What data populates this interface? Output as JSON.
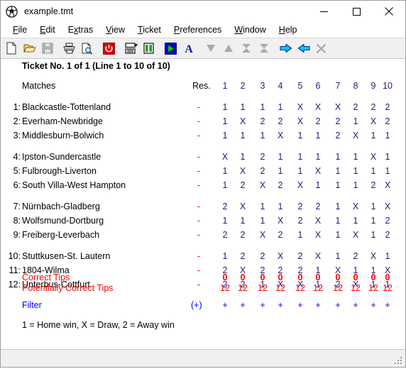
{
  "window": {
    "title": "example.tmt",
    "icon": "football-icon",
    "minimize_label": "─",
    "maximize_label": "□",
    "close_label": "✕"
  },
  "menu": [
    {
      "label": "File",
      "accel": "F"
    },
    {
      "label": "Edit",
      "accel": "E"
    },
    {
      "label": "Extras",
      "accel": "x"
    },
    {
      "label": "View",
      "accel": "V"
    },
    {
      "label": "Ticket",
      "accel": "T"
    },
    {
      "label": "Preferences",
      "accel": "P"
    },
    {
      "label": "Window",
      "accel": "W"
    },
    {
      "label": "Help",
      "accel": "H"
    }
  ],
  "toolbar": [
    {
      "name": "new-file-icon",
      "enabled": true
    },
    {
      "name": "open-folder-icon",
      "enabled": true
    },
    {
      "name": "save-disk-icon",
      "enabled": false
    },
    {
      "name": "print-icon",
      "enabled": true
    },
    {
      "name": "print-preview-icon",
      "enabled": true
    },
    {
      "name": "power-icon",
      "enabled": true
    },
    {
      "name": "split-horizontal-icon",
      "enabled": true
    },
    {
      "name": "split-vertical-icon",
      "enabled": true
    },
    {
      "name": "run-play-icon",
      "enabled": true
    },
    {
      "name": "font-letter-a-icon",
      "enabled": true
    },
    {
      "name": "move-down-icon",
      "enabled": false
    },
    {
      "name": "move-up-icon",
      "enabled": false
    },
    {
      "name": "move-bottom-icon",
      "enabled": false
    },
    {
      "name": "move-top-icon",
      "enabled": false
    },
    {
      "name": "arrow-right-icon",
      "enabled": true
    },
    {
      "name": "arrow-left-icon",
      "enabled": true
    },
    {
      "name": "delete-x-icon",
      "enabled": false
    }
  ],
  "sheet": {
    "heading": "Ticket No. 1 of 1 (Line 1 to 10 of 10)",
    "matches_header": "Matches",
    "res_header": "Res.",
    "column_headers": [
      "1",
      "2",
      "3",
      "4",
      "5",
      "6",
      "7",
      "8",
      "9",
      "10"
    ],
    "matches": [
      {
        "no": "1:",
        "name": "Blackcastle-Tottenland",
        "res": "-",
        "tips": [
          "1",
          "1",
          "1",
          "1",
          "X",
          "X",
          "X",
          "2",
          "2",
          "2"
        ]
      },
      {
        "no": "2:",
        "name": "Everham-Newbridge",
        "res": "-",
        "tips": [
          "1",
          "X",
          "2",
          "2",
          "X",
          "2",
          "2",
          "1",
          "X",
          "2"
        ]
      },
      {
        "no": "3:",
        "name": "Middlesburn-Bolwich",
        "res": "-",
        "tips": [
          "1",
          "1",
          "1",
          "X",
          "1",
          "1",
          "2",
          "X",
          "1",
          "1"
        ]
      },
      {
        "no": "4:",
        "name": "Ipston-Sundercastle",
        "res": "-",
        "tips": [
          "X",
          "1",
          "2",
          "1",
          "1",
          "1",
          "1",
          "1",
          "X",
          "1"
        ]
      },
      {
        "no": "5:",
        "name": "Fulbrough-Liverton",
        "res": "-",
        "tips": [
          "1",
          "X",
          "2",
          "1",
          "1",
          "X",
          "1",
          "1",
          "1",
          "1"
        ]
      },
      {
        "no": "6:",
        "name": "South Villa-West Hampton",
        "res": "-",
        "tips": [
          "1",
          "2",
          "X",
          "2",
          "X",
          "1",
          "1",
          "1",
          "2",
          "X"
        ]
      },
      {
        "no": "7:",
        "name": "Nürnbach-Gladberg",
        "res": "-",
        "tips": [
          "2",
          "X",
          "1",
          "1",
          "2",
          "2",
          "1",
          "X",
          "1",
          "X"
        ]
      },
      {
        "no": "8:",
        "name": "Wolfsmund-Dortburg",
        "res": "-",
        "tips": [
          "1",
          "1",
          "1",
          "X",
          "2",
          "X",
          "1",
          "1",
          "1",
          "2"
        ]
      },
      {
        "no": "9:",
        "name": "Freiberg-Leverbach",
        "res": "-",
        "tips": [
          "2",
          "2",
          "X",
          "2",
          "1",
          "X",
          "1",
          "X",
          "1",
          "2"
        ]
      },
      {
        "no": "10:",
        "name": "Stuttkusen-St. Lautern",
        "res": "-",
        "tips": [
          "1",
          "2",
          "2",
          "X",
          "2",
          "X",
          "1",
          "2",
          "X",
          "1"
        ]
      },
      {
        "no": "11:",
        "name": "1804-Wilma",
        "res": "-",
        "tips": [
          "2",
          "X",
          "2",
          "2",
          "2",
          "1",
          "X",
          "1",
          "1",
          "X"
        ]
      },
      {
        "no": "12:",
        "name": "Unterbus-Cottfurt",
        "res": "-",
        "tips": [
          "2",
          "2",
          "1",
          "X",
          "X",
          "1",
          "2",
          "X",
          "1",
          "1"
        ]
      }
    ],
    "correct_tips_label": "Correct Tips",
    "correct_tips_values": [
      "0",
      "0",
      "0",
      "0",
      "0",
      "0",
      "0",
      "0",
      "0",
      "0"
    ],
    "potential_tips_label": "Potentially Correct Tips",
    "potential_tips_values": [
      "12",
      "12",
      "12",
      "12",
      "12",
      "12",
      "12",
      "12",
      "12",
      "12"
    ],
    "filter_label": "Filter",
    "filter_res_value": "(+)",
    "filter_values": [
      "+",
      "+",
      "+",
      "+",
      "+",
      "+",
      "+",
      "+",
      "+",
      "+"
    ],
    "legend": "1 = Home win, X = Draw, 2 = Away win"
  },
  "colors": {
    "tip": "#20207a",
    "red": "#ff0000",
    "blue": "#0000ee",
    "toolbar_bg": "#f0f0f0"
  }
}
